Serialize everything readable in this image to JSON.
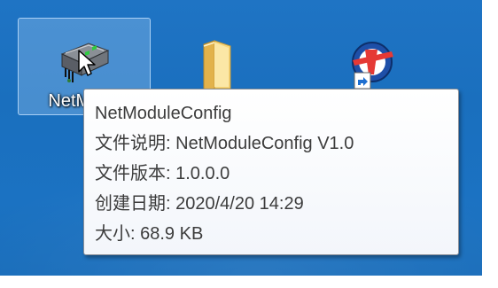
{
  "desktop": {
    "icons": [
      {
        "label": "NetModu",
        "icon": "network-module-icon",
        "selected": true
      },
      {
        "label": "",
        "icon": "folder-icon",
        "selected": false
      },
      {
        "label": "",
        "icon": "app-shortcut-icon",
        "selected": false
      }
    ]
  },
  "tooltip": {
    "title": "NetModuleConfig",
    "rows": [
      {
        "label": "文件说明: ",
        "value": "NetModuleConfig V1.0"
      },
      {
        "label": "文件版本: ",
        "value": "1.0.0.0"
      },
      {
        "label": "创建日期: ",
        "value": "2020/4/20 14:29"
      },
      {
        "label": "大小: ",
        "value": "68.9 KB"
      }
    ]
  },
  "colors": {
    "desktop_bg": "#1f74c4",
    "tooltip_bg": "#ffffff",
    "tooltip_text": "#3c3c3c",
    "selection": "#a0c8f0"
  }
}
